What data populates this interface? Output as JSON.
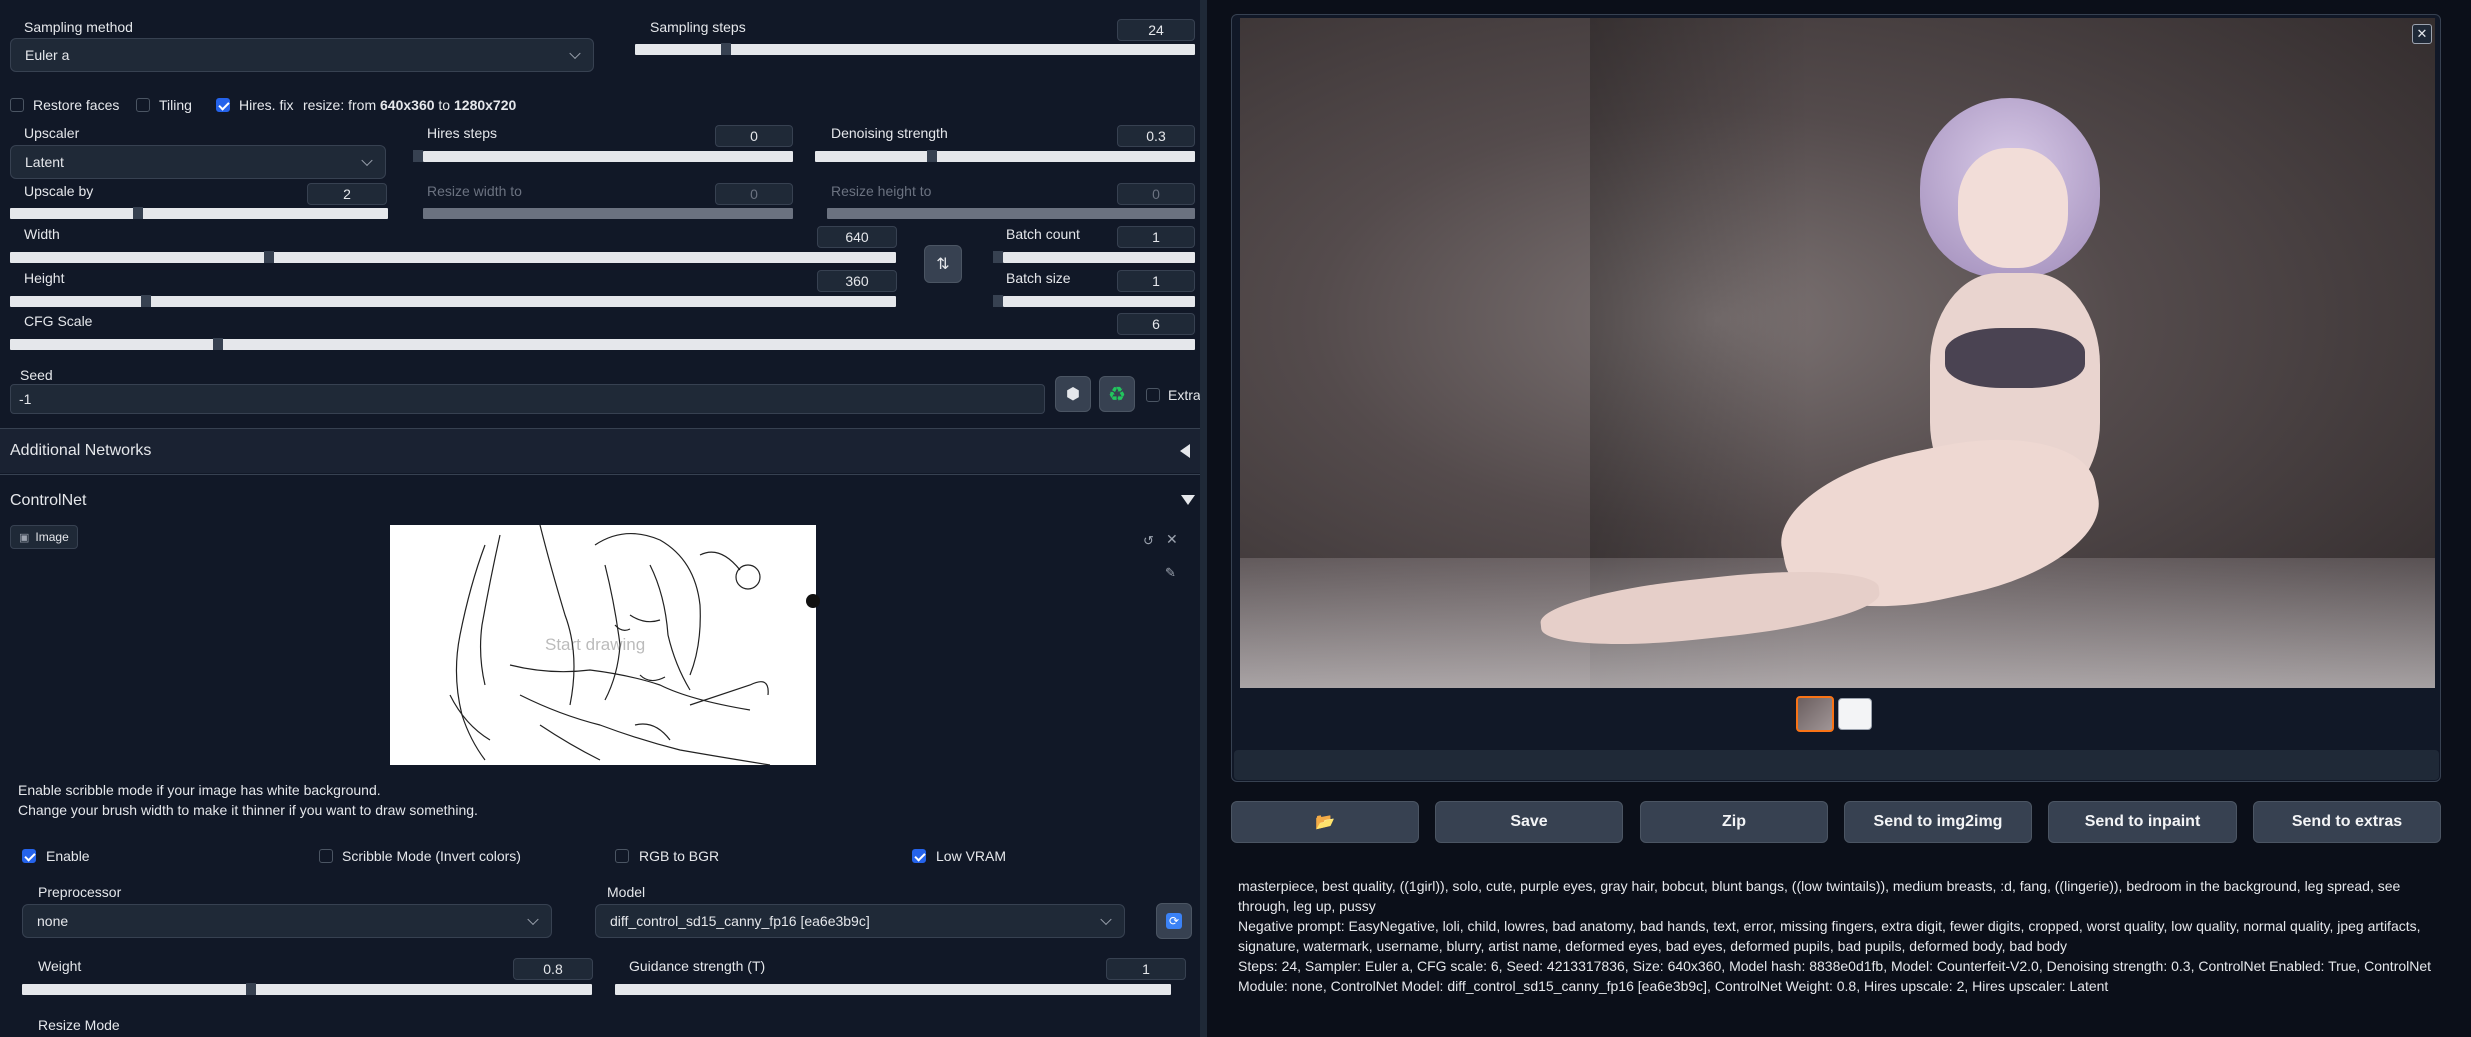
{
  "sampling": {
    "method_label": "Sampling method",
    "method_value": "Euler a",
    "steps_label": "Sampling steps",
    "steps_value": "24",
    "steps_fraction": 0.16
  },
  "options": {
    "restore_faces": "Restore faces",
    "tiling": "Tiling",
    "hires_fix": "Hires. fix",
    "resize_prefix": "resize: from ",
    "resize_from": "640x360",
    "resize_mid": " to ",
    "resize_to": "1280x720"
  },
  "hires": {
    "upscaler_label": "Upscaler",
    "upscaler_value": "Latent",
    "steps_label": "Hires steps",
    "steps_value": "0",
    "denoise_label": "Denoising strength",
    "denoise_value": "0.3",
    "upscale_by_label": "Upscale by",
    "upscale_by_value": "2",
    "resize_w_label": "Resize width to",
    "resize_w_value": "0",
    "resize_h_label": "Resize height to",
    "resize_h_value": "0"
  },
  "dims": {
    "width_label": "Width",
    "width_value": "640",
    "height_label": "Height",
    "height_value": "360",
    "batch_count_label": "Batch count",
    "batch_count_value": "1",
    "batch_size_label": "Batch size",
    "batch_size_value": "1",
    "cfg_label": "CFG Scale",
    "cfg_value": "6"
  },
  "seed": {
    "label": "Seed",
    "value": "-1",
    "extra_label": "Extra",
    "dice_icon": "dice-icon",
    "recycle_icon": "recycle-icon"
  },
  "additional_networks": {
    "title": "Additional Networks"
  },
  "controlnet": {
    "title": "ControlNet",
    "image_tab": "Image",
    "canvas_placeholder": "Start drawing",
    "hint1": "Enable scribble mode if your image has white background.",
    "hint2": "Change your brush width to make it thinner if you want to draw something.",
    "enable": "Enable",
    "scribble": "Scribble Mode (Invert colors)",
    "rgb_bgr": "RGB to BGR",
    "low_vram": "Low VRAM",
    "preprocessor_label": "Preprocessor",
    "preprocessor_value": "none",
    "model_label": "Model",
    "model_value": "diff_control_sd15_canny_fp16 [ea6e3b9c]",
    "weight_label": "Weight",
    "weight_value": "0.8",
    "guidance_label": "Guidance strength (T)",
    "guidance_value": "1",
    "resize_mode_label": "Resize Mode"
  },
  "output": {
    "buttons": {
      "folder_icon": "folder-icon",
      "save": "Save",
      "zip": "Zip",
      "img2img": "Send to img2img",
      "inpaint": "Send to inpaint",
      "extras": "Send to extras"
    },
    "info_prompt": "masterpiece, best quality, ((1girl)), solo, cute, purple eyes, gray hair, bobcut, blunt bangs, ((low twintails)), medium breasts, :d, fang, ((lingerie)), bedroom in the background, leg spread, see through, leg up, pussy",
    "info_negative": "Negative prompt: EasyNegative, loli, child, lowres, bad anatomy, bad hands, text, error, missing fingers, extra digit, fewer digits, cropped, worst quality, low quality, normal quality, jpeg artifacts, signature, watermark, username, blurry, artist name, deformed eyes, bad eyes, deformed pupils, bad pupils, deformed body, bad body",
    "info_params": "Steps: 24, Sampler: Euler a, CFG scale: 6, Seed: 4213317836, Size: 640x360, Model hash: 8838e0d1fb, Model: Counterfeit-V2.0, Denoising strength: 0.3, ControlNet Enabled: True, ControlNet Module: none, ControlNet Model: diff_control_sd15_canny_fp16 [ea6e3b9c], ControlNet Weight: 0.8, Hires upscale: 2, Hires upscaler: Latent"
  },
  "colors": {
    "bg": "#0b0f19",
    "panel": "#1f2937",
    "accent": "#2563eb",
    "slider": "#e5e7eb",
    "selected_thumb": "#f97316"
  }
}
